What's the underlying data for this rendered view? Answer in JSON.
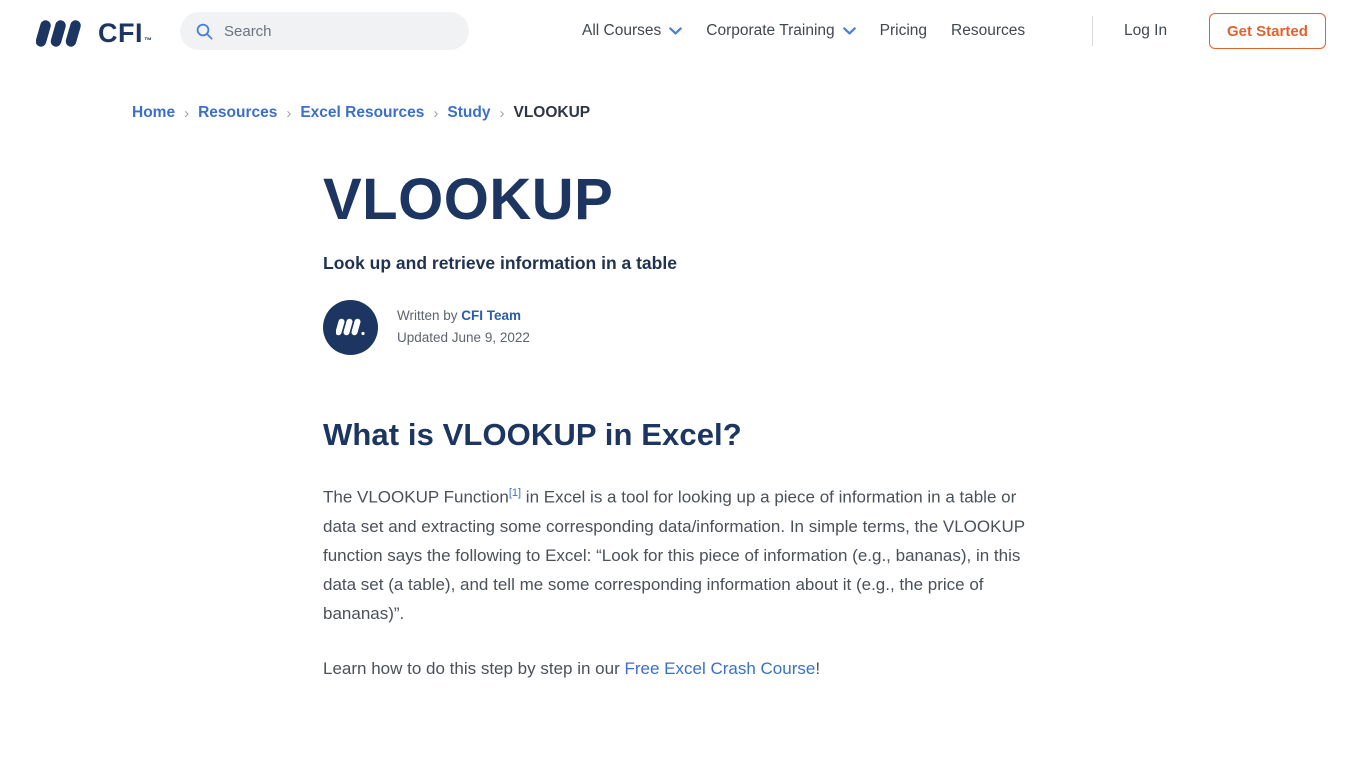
{
  "header": {
    "logo": {
      "word": "CFI",
      "tm": "™",
      "icon": "cfi-logo-icon"
    },
    "search": {
      "placeholder": "Search",
      "value": "",
      "icon": "search-icon"
    },
    "nav_items": [
      {
        "label": "All Courses",
        "has_dropdown": true
      },
      {
        "label": "Corporate Training",
        "has_dropdown": true
      },
      {
        "label": "Pricing",
        "has_dropdown": false
      },
      {
        "label": "Resources",
        "has_dropdown": false
      }
    ],
    "login_label": "Log In",
    "get_started_label": "Get Started"
  },
  "breadcrumb": {
    "separator": "›",
    "items": [
      {
        "label": "Home",
        "current": false
      },
      {
        "label": "Resources",
        "current": false
      },
      {
        "label": "Excel Resources",
        "current": false
      },
      {
        "label": "Study",
        "current": false
      },
      {
        "label": "VLOOKUP",
        "current": true
      }
    ]
  },
  "article": {
    "title": "VLOOKUP",
    "subtitle": "Look up and retrieve information in a table",
    "byline": {
      "written_by_prefix": "Written by ",
      "author": "CFI Team",
      "updated": "Updated June 9, 2022",
      "avatar_icon": "cfi-avatar-icon"
    },
    "section_heading": "What is VLOOKUP in Excel?",
    "paragraph_1_part_1": "The VLOOKUP Function",
    "paragraph_1_citation": "[1]",
    "paragraph_1_part_2": " in Excel is a tool for looking up a piece of information in a table or data set and extracting some corresponding data/information.  In simple terms, the VLOOKUP function says the following to Excel: “Look for this piece of information (e.g., bananas), in this data set (a table), and tell me some corresponding information about it (e.g., the price of bananas)”.",
    "paragraph_2_part_1": "Learn how to do this step by step in our ",
    "paragraph_2_link": "Free Excel Crash Course",
    "paragraph_2_part_2": "!"
  },
  "colors": {
    "navy": "#1c3661",
    "link_blue": "#3b6fc9",
    "accent_orange": "#e2622c",
    "body_text": "#4a5159",
    "search_bg": "#f1f2f4"
  }
}
